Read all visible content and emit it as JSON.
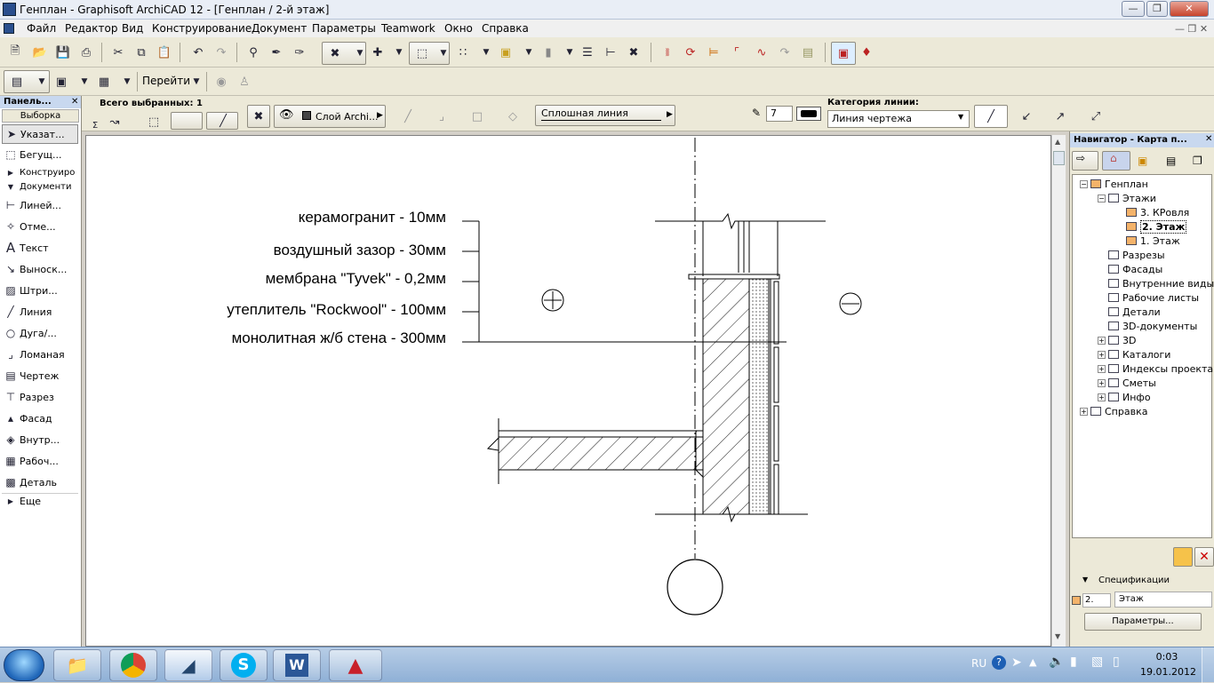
{
  "window": {
    "title": "Генплан - Graphisoft ArchiCAD 12 - [Генплан / 2-й этаж]"
  },
  "menu": [
    "Файл",
    "Редактор",
    "Вид",
    "Конструирование",
    "Документ",
    "Параметры",
    "Teamwork",
    "Окно",
    "Справка"
  ],
  "toolbar2": {
    "goto_label": "Перейти"
  },
  "infobox": {
    "selected_label": "Всего выбранных: 1",
    "layer_label": "Слой Archi...",
    "linetype_label": "Сплошная линия",
    "pen_number": "7",
    "line_category_label": "Категория линии:",
    "line_category_value": "Линия чертежа"
  },
  "toolbox": {
    "title": "Панель...",
    "selection_tab": "Выборка",
    "items": [
      "Указат...",
      "Бегущ...",
      "Конструиро",
      "Документи",
      "Линей...",
      "Отме...",
      "Текст",
      "Выноск...",
      "Штри...",
      "Линия",
      "Дуга/...",
      "Ломаная",
      "Чертеж",
      "Разрез",
      "Фасад",
      "Внутр...",
      "Рабоч...",
      "Деталь",
      "Еще"
    ]
  },
  "drawing": {
    "labels": [
      "керамогранит - 10мм",
      "воздушный зазор - 30мм",
      "мембрана \"Tyvek\" - 0,2мм",
      "утеплитель \"Rockwool\" - 100мм",
      "монолитная ж/б стена - 300мм"
    ]
  },
  "navigator": {
    "title": "Навигатор - Карта п...",
    "tree": [
      "Генплан",
      "Этажи",
      "3. КРовля",
      "2. Этаж",
      "1. Этаж",
      "Разрезы",
      "Фасады",
      "Внутренние виды",
      "Рабочие листы",
      "Детали",
      "3D-документы",
      "3D",
      "Каталоги",
      "Индексы проекта",
      "Сметы",
      "Инфо",
      "Справка"
    ],
    "spec_title": "Спецификации",
    "spec_num": "2.",
    "spec_name": "Этаж",
    "params_button": "Параметры..."
  },
  "tray": {
    "lang": "RU",
    "time": "0:03",
    "date": "19.01.2012"
  }
}
